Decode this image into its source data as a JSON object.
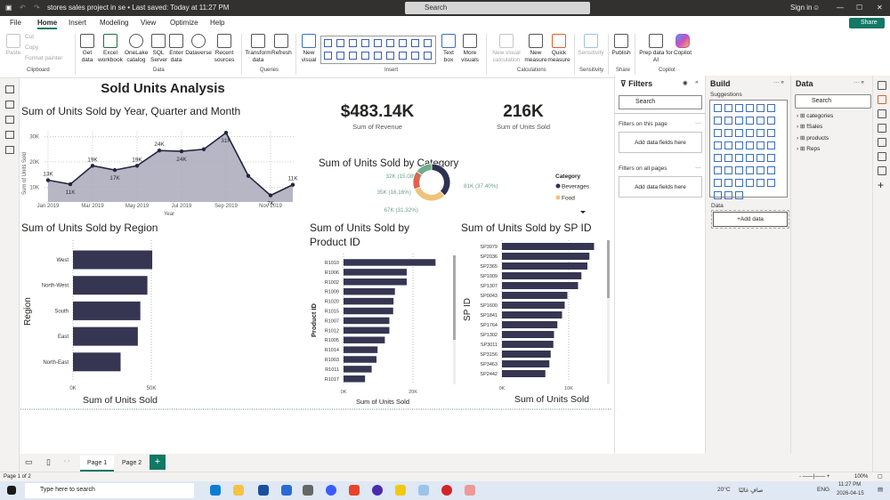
{
  "titlebar": {
    "doc_title": "stores sales project in se • Last saved: Today at 11:27 PM",
    "search": "Search",
    "sign_in": "Sign in"
  },
  "menu": {
    "tabs": [
      "File",
      "Home",
      "Insert",
      "Modeling",
      "View",
      "Optimize",
      "Help"
    ],
    "active": "Home",
    "share": "Share"
  },
  "ribbon": {
    "clipboard": {
      "paste": "Paste",
      "cut": "Cut",
      "copy": "Copy",
      "format_painter": "Format painter",
      "group": "Clipboard"
    },
    "data": {
      "items": [
        "Get data",
        "Excel workbook",
        "OneLake catalog",
        "SQL Server",
        "Enter data",
        "Dataverse",
        "Recent sources"
      ],
      "group": "Data"
    },
    "queries": {
      "items": [
        "Transform data",
        "Refresh"
      ],
      "group": "Queries"
    },
    "insert": {
      "new_visual": "New visual",
      "text_box": "Text box",
      "more_visuals": "More visuals",
      "group": "Insert"
    },
    "calculations": {
      "items": [
        "New visual calculation",
        "New measure",
        "Quick measure"
      ],
      "group": "Calculations"
    },
    "sensitivity": {
      "item": "Sensitivity",
      "group": "Sensitivity"
    },
    "share": {
      "item": "Publish",
      "group": "Share"
    },
    "copilot": {
      "items": [
        "Prep data for AI",
        "Copilot"
      ],
      "group": "Copilot"
    }
  },
  "report": {
    "title": "Sold Units Analysis",
    "kpis": [
      {
        "value": "$483.14K",
        "label": "Sum of Revenue"
      },
      {
        "value": "216K",
        "label": "Sum of Units Sold"
      }
    ]
  },
  "colors": {
    "bar": "#363652",
    "area": "#a9a9ba",
    "line": "#252540",
    "accent": "#117865",
    "donut": [
      "#2e3150",
      "#eec47c",
      "#e5604b",
      "#6fae8c"
    ]
  },
  "chart_data": [
    {
      "type": "area",
      "title": "Sum of Units Sold by Year, Quarter and Month",
      "xlabel": "Year",
      "ylabel": "Sum of Units Sold",
      "x": [
        "Jan 2019",
        "Feb 2019",
        "Mar 2019",
        "Apr 2019",
        "May 2019",
        "Jun 2019",
        "Jul 2019",
        "Aug 2019",
        "Sep 2019",
        "Oct 2019",
        "Nov 2019",
        "Dec 2019"
      ],
      "xticks": [
        "Jan 2019",
        "Mar 2019",
        "May 2019",
        "Jul 2019",
        "Sep 2019",
        "Nov 2019"
      ],
      "values": [
        12800,
        11200,
        18500,
        16800,
        18500,
        24500,
        24200,
        25000,
        31500,
        14500,
        6800,
        11000
      ],
      "data_labels": [
        "13K",
        "11K",
        "19K",
        "17K",
        "19K",
        "24K",
        "24K",
        "",
        "31K",
        "",
        "7K",
        "11K"
      ],
      "yticks": [
        "10K",
        "20K",
        "30K"
      ],
      "yticks_values": [
        10000,
        20000,
        30000
      ],
      "grid": true
    },
    {
      "type": "pie",
      "variant": "donut",
      "title": "Sum of Units Sold by Category",
      "legend_title": "Category",
      "legend_position": "right",
      "legend": [
        "Beverages",
        "Food"
      ],
      "values": [
        81000,
        67000,
        35000,
        32000
      ],
      "labels": [
        "81K (37.40%)",
        "67K (31.32%)",
        "35K (16.16%)",
        "32K (15.08%)"
      ]
    },
    {
      "type": "bar",
      "orientation": "horizontal",
      "title": "Sum of Units Sold by Region",
      "xlabel": "Sum of Units Sold",
      "ylabel": "Region",
      "categories": [
        "West",
        "North-West",
        "South",
        "East",
        "North-East"
      ],
      "values": [
        50600,
        47500,
        43000,
        41400,
        30400
      ],
      "xticks": [
        "0K",
        "50K"
      ],
      "xticks_values": [
        0,
        50000
      ],
      "xlim": [
        0,
        50000
      ]
    },
    {
      "type": "bar",
      "orientation": "horizontal",
      "title": "Sum of Units Sold by Product ID",
      "xlabel": "Sum of Units Sold",
      "ylabel": "Product ID",
      "categories": [
        "R1010",
        "R1006",
        "R1002",
        "R1009",
        "R1020",
        "R1015",
        "R1007",
        "R1012",
        "R1005",
        "R1014",
        "R1003",
        "R1011",
        "R1017"
      ],
      "values": [
        26500,
        18200,
        18200,
        14800,
        14400,
        14300,
        13200,
        13200,
        11900,
        9800,
        9500,
        8100,
        6200
      ],
      "xticks": [
        "0K",
        "20K"
      ],
      "xticks_values": [
        0,
        20000
      ],
      "xlim": [
        0,
        20000
      ]
    },
    {
      "type": "bar",
      "orientation": "horizontal",
      "title": "Sum of Units Sold by SP ID",
      "xlabel": "Sum of Units Sold",
      "ylabel": "SP ID",
      "categories": [
        "SP3979",
        "SP2036",
        "SP2365",
        "SP1009",
        "SP1307",
        "SP0043",
        "SP1600",
        "SP1841",
        "SP1764",
        "SP1302",
        "SP3011",
        "SP3156",
        "SP3463",
        "SP2442"
      ],
      "values": [
        13800,
        13100,
        12800,
        11900,
        11400,
        9800,
        9400,
        9000,
        8300,
        7800,
        7700,
        7300,
        7100,
        6500
      ],
      "xticks": [
        "0K",
        "10K"
      ],
      "xticks_values": [
        0,
        10000
      ],
      "xlim": [
        0,
        10000
      ]
    }
  ],
  "filters": {
    "title": "Filters",
    "search": "Search",
    "this_page": "Filters on this page",
    "all_pages": "Filters on all pages",
    "add_fields": "Add data fields here"
  },
  "build": {
    "title": "Build",
    "suggestions": "Suggestions",
    "data_label": "Data",
    "add_data": "+Add data"
  },
  "data_pane": {
    "title": "Data",
    "search": "Search",
    "tables": [
      "categories",
      "fSales",
      "products",
      "Reps"
    ]
  },
  "pages": {
    "tabs": [
      "Page 1",
      "Page 2"
    ],
    "active": "Page 1",
    "status": "Page 1 of 2",
    "zoom": "100%"
  },
  "taskbar": {
    "search": "Type here to search",
    "weather": "20°C",
    "weather_text": "صافٍ غالبًا",
    "lang": "ENG",
    "time": "11:27 PM",
    "date": "2026-04-15"
  }
}
